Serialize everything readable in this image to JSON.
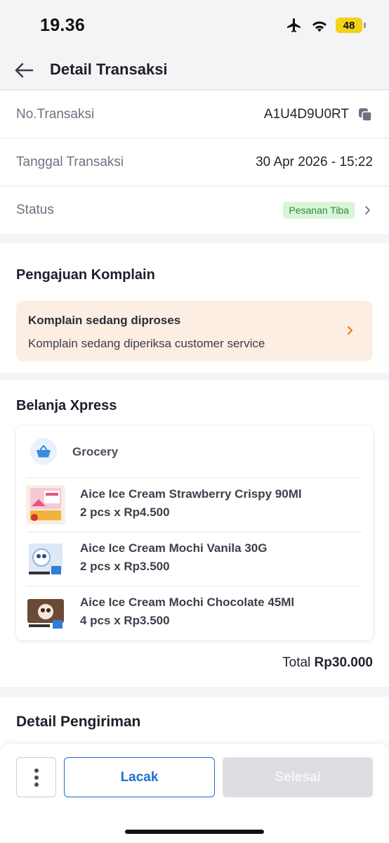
{
  "statusbar": {
    "time": "19.36",
    "battery": "48"
  },
  "header": {
    "title": "Detail Transaksi"
  },
  "info": {
    "no_label": "No.Transaksi",
    "no_value": "A1U4D9U0RT",
    "date_label": "Tanggal Transaksi",
    "date_value": "30 Apr 2026 - 15:22",
    "status_label": "Status",
    "status_value": "Pesanan Tiba"
  },
  "complaint": {
    "section_title": "Pengajuan Komplain",
    "title": "Komplain sedang diproses",
    "desc": "Komplain sedang diperiksa customer service"
  },
  "order": {
    "section_title": "Belanja Xpress",
    "category": "Grocery",
    "items": [
      {
        "name": "Aice Ice Cream Strawberry Crispy 90Ml",
        "qty": "2 pcs x Rp4.500"
      },
      {
        "name": "Aice Ice Cream Mochi Vanila 30G",
        "qty": "2 pcs x Rp3.500"
      },
      {
        "name": "Aice Ice Cream Mochi Chocolate 45Ml",
        "qty": "4 pcs x Rp3.500"
      }
    ],
    "total_label": "Total",
    "total_value": "Rp30.000"
  },
  "shipping": {
    "section_title": "Detail Pengiriman"
  },
  "actions": {
    "track": "Lacak",
    "done": "Selesai"
  },
  "colors": {
    "primary": "#1f6fd1",
    "badge_bg": "#d8f5d8",
    "complaint_bg": "#fdeee3",
    "accent_orange": "#e8831f"
  }
}
